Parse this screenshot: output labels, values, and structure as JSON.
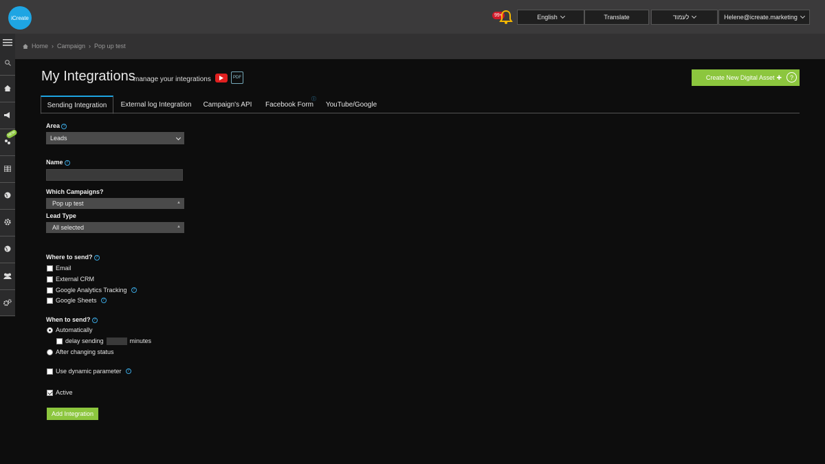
{
  "header": {
    "logo_text": "iCreate",
    "notification_count": "99+",
    "language_label": "English",
    "translate_label": "Translate",
    "hebrew_label": "לעמוד",
    "user_email": "Helene@icreate.marketing"
  },
  "sidebar": {
    "items": [
      "menu-icon",
      "search-icon",
      "home-icon",
      "megaphone-icon",
      "new-feature-icon",
      "table-icon",
      "globe-icon",
      "gear-icon",
      "globe-icon",
      "users-icon",
      "cogs-icon"
    ],
    "new_badge": "NEW"
  },
  "breadcrumb": {
    "home": "Home",
    "campaign": "Campaign",
    "current": "Pop up test"
  },
  "page": {
    "title": "My Integrations",
    "subtitle": "manage your integrations",
    "pdf_label": "PDF",
    "create_button": "Create New Digital Asset",
    "create_plus": "✚",
    "help_symbol": "?"
  },
  "tabs": [
    {
      "label": "Sending Integration",
      "active": true
    },
    {
      "label": "External log Integration",
      "active": false
    },
    {
      "label": "Campaign's API",
      "active": false
    },
    {
      "label": "Facebook Form",
      "active": false
    },
    {
      "label": "YouTube/Google",
      "active": false
    }
  ],
  "form": {
    "area_label": "Area",
    "area_value": "Leads",
    "name_label": "Name",
    "name_value": "",
    "campaigns_label": "Which Campaigns?",
    "campaigns_value": "Pop up test",
    "lead_type_label": "Lead Type",
    "lead_type_value": "All selected",
    "where_label": "Where to send?",
    "where_options": [
      {
        "label": "Email",
        "checked": false,
        "help": false
      },
      {
        "label": "External CRM",
        "checked": false,
        "help": false
      },
      {
        "label": "Google Analytics Tracking",
        "checked": false,
        "help": true
      },
      {
        "label": "Google Sheets",
        "checked": false,
        "help": true
      }
    ],
    "when_label": "When to send?",
    "when_auto": "Automatically",
    "delay_label": "delay sending",
    "delay_value": "",
    "minutes_label": "minutes",
    "after_status": "After changing status",
    "dynamic_param": "Use dynamic parameter",
    "active_label": "Active",
    "active_checked": true,
    "submit": "Add Integration"
  },
  "colors": {
    "accent_green": "#8cc63e",
    "accent_blue": "#1ea5e3",
    "background": "#0d0d0d",
    "topbar": "#3b3a3b"
  }
}
